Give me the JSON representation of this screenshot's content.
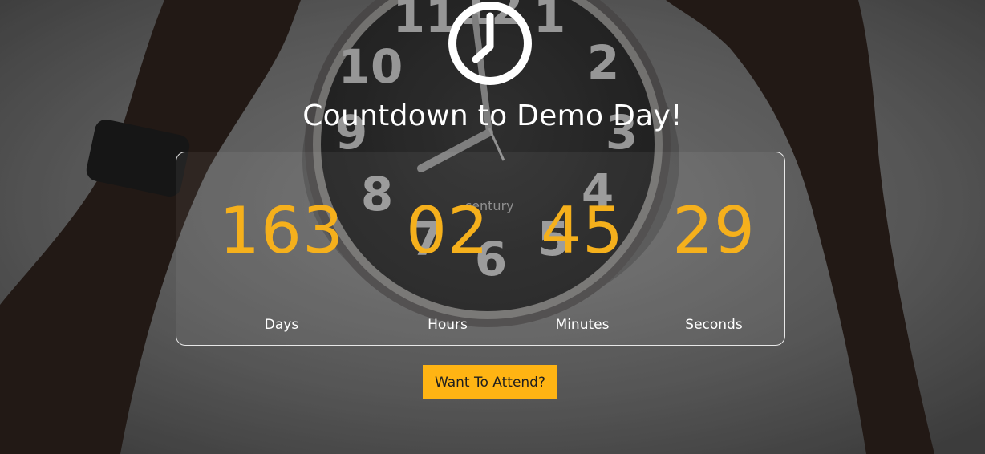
{
  "header": {
    "icon": "clock-icon",
    "title": "Countdown to Demo Day!"
  },
  "countdown": {
    "days": {
      "value": "163",
      "label": "Days"
    },
    "hours": {
      "value": "02",
      "label": "Hours"
    },
    "minutes": {
      "value": "45",
      "label": "Minutes"
    },
    "seconds": {
      "value": "29",
      "label": "Seconds"
    }
  },
  "cta": {
    "label": "Want To Attend?"
  },
  "background": {
    "clock_numerals": [
      "11",
      "12",
      "1",
      "10",
      "2",
      "9",
      "3",
      "8",
      "4",
      "7",
      "6",
      "5"
    ],
    "clock_brand": "century"
  },
  "colors": {
    "accent": "#ffb413",
    "digits": "#f5b01c",
    "text": "#ffffff"
  }
}
